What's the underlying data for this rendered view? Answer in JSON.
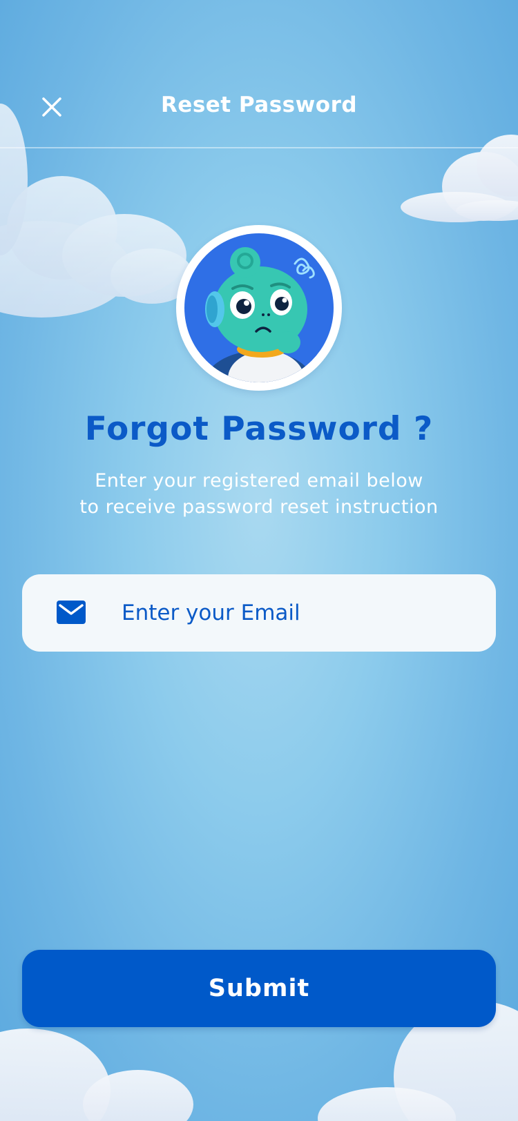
{
  "header": {
    "title": "Reset Password",
    "close_icon": "close-icon"
  },
  "avatar": {
    "icon": "confused-mascot-avatar"
  },
  "content": {
    "headline": "Forgot Password ?",
    "subtitle_line1": "Enter your registered email below",
    "subtitle_line2": "to receive password reset instruction"
  },
  "email": {
    "icon": "mail-icon",
    "placeholder": "Enter your Email",
    "value": ""
  },
  "submit": {
    "label": "Submit"
  },
  "colors": {
    "accent": "#0059c9",
    "headline": "#0b5ac7",
    "sky": "#8ccbec",
    "field_bg": "#f3f8fb"
  }
}
